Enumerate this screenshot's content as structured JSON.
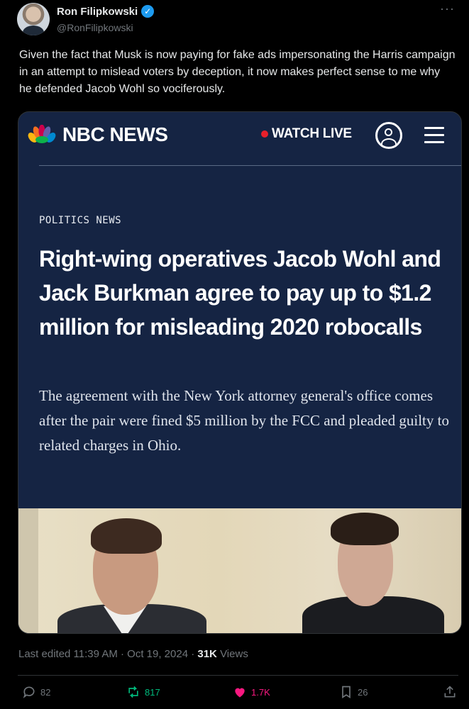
{
  "author": {
    "name": "Ron Filipkowski",
    "handle": "@RonFilipkowski",
    "verified_glyph": "✓"
  },
  "more_label": "···",
  "tweet_text": "Given the fact that Musk is now paying for fake ads impersonating the Harris campaign in an attempt to mislead voters by deception, it now makes perfect sense to me why he defended Jacob Wohl so vociferously.",
  "card": {
    "brand": "NBC NEWS",
    "watch_live": "WATCH LIVE",
    "kicker": "POLITICS NEWS",
    "headline": "Right-wing operatives Jacob Wohl and Jack Burkman agree to pay up to $1.2 million for misleading 2020 robocalls",
    "dek": "The agreement with the New York attorney general's office comes after the pair were fined $5 million by the FCC and pleaded guilty to related charges in Ohio."
  },
  "meta": {
    "edited": "Last edited 11:39 AM · Oct 19, 2024 · ",
    "views_count": "31K",
    "views_label": " Views"
  },
  "actions": {
    "replies": "82",
    "reposts": "817",
    "likes": "1.7K",
    "bookmarks": "26"
  },
  "colors": {
    "background": "#000000",
    "card_navy": "#152443",
    "verified": "#1d9bf0",
    "repost_green": "#00ba7c",
    "like_pink": "#f91880",
    "live_red": "#e8202b"
  },
  "icons": [
    "verified-badge-icon",
    "more-icon",
    "peacock-logo-icon",
    "live-dot-icon",
    "user-account-icon",
    "hamburger-menu-icon",
    "reply-icon",
    "repost-icon",
    "like-icon",
    "bookmark-icon",
    "share-icon"
  ]
}
